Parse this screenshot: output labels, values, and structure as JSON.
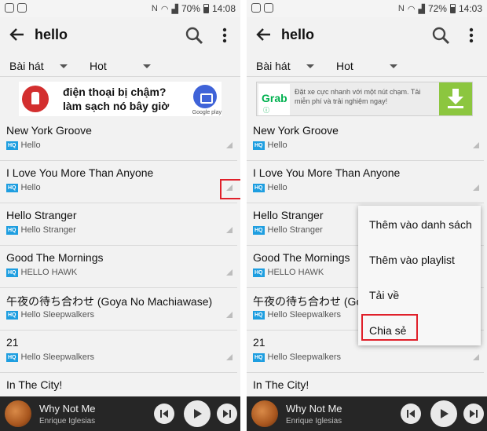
{
  "left": {
    "status": {
      "signal": "N",
      "battery": "70%",
      "time": "14:08"
    },
    "search_query": "hello",
    "filters": {
      "type": "Bài hát",
      "sort": "Hot"
    },
    "ad": {
      "text_line1": "điện thoại bị chậm?",
      "text_line2": "làm sạch nó bây giờ",
      "store": "Google play"
    },
    "songs": [
      {
        "title": "New York Groove",
        "artist": "Hello",
        "badge": "HQ"
      },
      {
        "title": "I Love You More Than Anyone",
        "artist": "Hello",
        "badge": "HQ"
      },
      {
        "title": "Hello Stranger",
        "artist": "Hello Stranger",
        "badge": "HQ"
      },
      {
        "title": "Good The Mornings",
        "artist": "HELLO HAWK",
        "badge": "HQ"
      },
      {
        "title": "午夜の待ち合わせ (Goya No Machiawase)",
        "artist": "Hello Sleepwalkers",
        "badge": "HQ"
      },
      {
        "title": "21",
        "artist": "Hello Sleepwalkers",
        "badge": "HQ"
      },
      {
        "title": "In The City!",
        "artist": "",
        "badge": ""
      }
    ],
    "player": {
      "title": "Why Not Me",
      "artist": "Enrique Iglesias"
    }
  },
  "right": {
    "status": {
      "signal": "N",
      "battery": "72%",
      "time": "14:03"
    },
    "search_query": "hello",
    "filters": {
      "type": "Bài hát",
      "sort": "Hot"
    },
    "ad": {
      "brand": "Grab",
      "badge": "ⓘ",
      "text": "Đặt xe cực nhanh với một nút chạm. Tải miễn phí và trải nghiệm ngay!"
    },
    "songs": [
      {
        "title": "New York Groove",
        "artist": "Hello",
        "badge": "HQ"
      },
      {
        "title": "I Love You More Than Anyone",
        "artist": "Hello",
        "badge": "HQ"
      },
      {
        "title": "Hello Stranger",
        "artist": "Hello Stranger",
        "badge": "HQ"
      },
      {
        "title": "Good The Mornings",
        "artist": "HELLO HAWK",
        "badge": "HQ"
      },
      {
        "title": "午夜の待ち合わせ (Goya",
        "artist": "Hello Sleepwalkers",
        "badge": "HQ"
      },
      {
        "title": "21",
        "artist": "Hello Sleepwalkers",
        "badge": "HQ"
      },
      {
        "title": "In The City!",
        "artist": "",
        "badge": ""
      }
    ],
    "menu": [
      "Thêm vào danh sách",
      "Thêm vào playlist",
      "Tải về",
      "Chia sẻ"
    ],
    "player": {
      "title": "Why Not Me",
      "artist": "Enrique Iglesias"
    }
  },
  "colors": {
    "highlight": "#e0202a",
    "hq_badge": "#1e9ee0",
    "player_bg": "#262626",
    "grab_green": "#00b14f"
  }
}
